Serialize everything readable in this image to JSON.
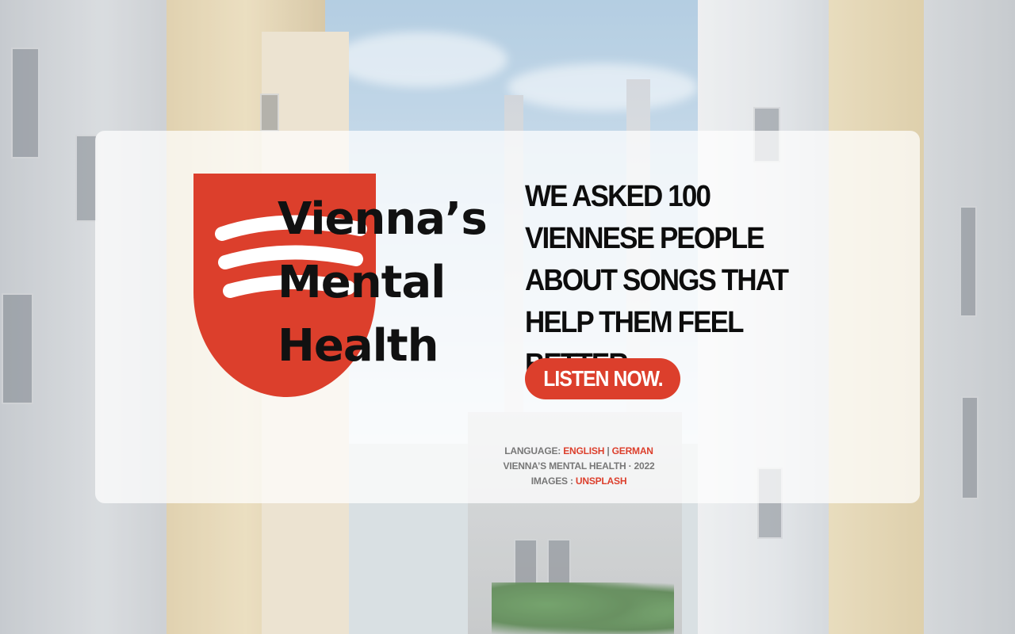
{
  "logo": {
    "line1": "Vienna’s",
    "line2": "Mental",
    "line3": "Health",
    "shield_color": "#dc3f2c"
  },
  "headline": "We asked 100 Viennese people about songs that help them feel better.",
  "cta_label": "Listen now.",
  "footer": {
    "language_label": "Language:",
    "language_english": "English",
    "language_separator": "|",
    "language_german": "German",
    "credit": "Vienna’s Mental Health · 2022",
    "images_label": "Images :",
    "images_source": "Unsplash"
  },
  "colors": {
    "accent": "#dc3f2c",
    "text": "#0d0d0d",
    "muted": "#777777"
  }
}
